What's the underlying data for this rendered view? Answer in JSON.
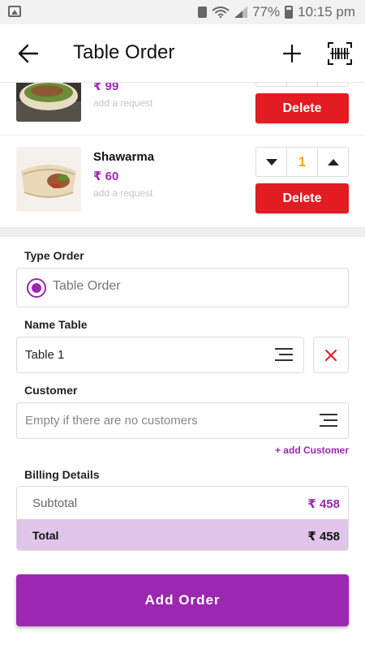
{
  "status_bar": {
    "battery": "77%",
    "time": "10:15 pm",
    "icons": [
      "image-icon",
      "sim-icon",
      "wifi-icon",
      "signal-icon",
      "battery-icon"
    ]
  },
  "header": {
    "title": "Table Order",
    "icons": [
      "back-arrow-icon",
      "plus-icon",
      "barcode-scan-icon"
    ]
  },
  "cart": {
    "items": [
      {
        "name": "",
        "price": "₹ 99",
        "request_placeholder": "add a request",
        "quantity": "",
        "delete_label": "Delete"
      },
      {
        "name": "Shawarma",
        "price": "₹ 60",
        "request_placeholder": "add a request",
        "quantity": "1",
        "delete_label": "Delete"
      }
    ]
  },
  "form": {
    "type_order": {
      "label": "Type Order",
      "value": "Table Order",
      "selected": true
    },
    "name_table": {
      "label": "Name Table",
      "value": "Table 1"
    },
    "customer": {
      "label": "Customer",
      "placeholder": "Empty if there are no customers",
      "add_link": "+ add Customer"
    }
  },
  "billing": {
    "label": "Billing Details",
    "subtotal_label": "Subtotal",
    "subtotal_value": "₹ 458",
    "total_label": "Total",
    "total_value": "₹ 458"
  },
  "actions": {
    "add_order": "Add Order"
  },
  "colors": {
    "accent": "#9c27b0",
    "delete": "#e31b23",
    "qty": "#f5a700",
    "total_bg": "#e1c4ea"
  }
}
